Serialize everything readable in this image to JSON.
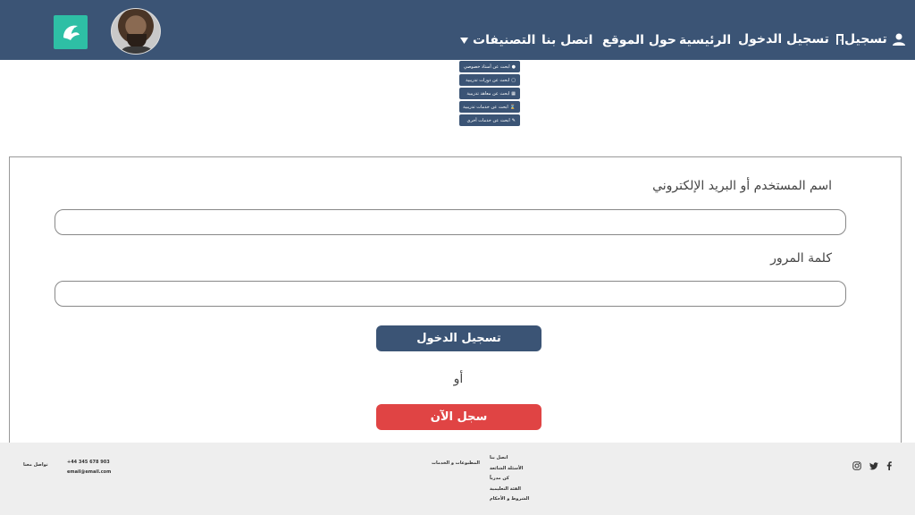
{
  "nav": {
    "register": "تسجيل",
    "login": "تسجيل الدخول",
    "home": "الرئيسية",
    "about": "حول الموقع",
    "contact": "اتصل بنا",
    "categories": "التصنيفات"
  },
  "dropdown": {
    "items": [
      {
        "label": "ابحث عن أستاذ خصوصي",
        "icon": "user-icon"
      },
      {
        "label": "ابحث عن دورات تدريبية",
        "icon": "laptop-icon"
      },
      {
        "label": "ابحث عن معاهد تدريبية",
        "icon": "building-icon"
      },
      {
        "label": "ابحث عن خدمات تدريبية",
        "icon": "hourglass-icon"
      },
      {
        "label": "ابحث عن خدمات أخرى",
        "icon": "edit-icon"
      }
    ]
  },
  "form": {
    "username_label": "اسم المستخدم أو البريد الإلكتروني",
    "password_label": "كلمة المرور",
    "username_value": "",
    "password_value": "",
    "login_button": "تسجيل الدخول",
    "or_text": "أو",
    "register_button": "سجل الآن"
  },
  "footer": {
    "contact_heading": "تواصل معنا",
    "phone": "+44 345 678 903",
    "email": "email@email.com",
    "terms": "المطبوعات و الخدمات",
    "links": [
      "اتصل بنا",
      "الأسئلة الشائعة",
      "كن مدرباً",
      "الفئة التعليمية",
      "الشروط و الأحكام"
    ]
  },
  "colors": {
    "primary": "#3b5475",
    "accent": "#2ebfa5",
    "danger": "#e04444",
    "footer_bg": "#eeeeee"
  }
}
